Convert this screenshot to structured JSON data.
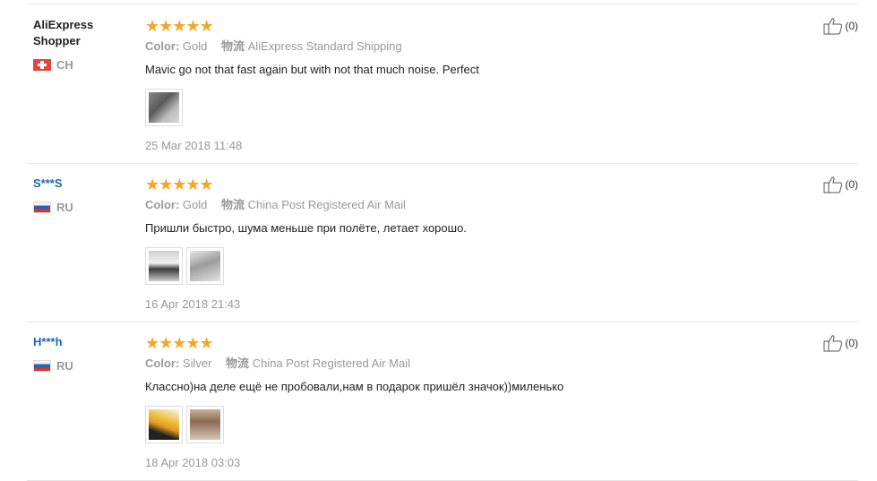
{
  "reviews": [
    {
      "user_name": "AliExpress Shopper",
      "country_code": "CH",
      "flag": "switzerland-flag",
      "rating": "★★★★★",
      "color_label": "Color:",
      "color_value": "Gold",
      "shipping_label": "物流",
      "shipping_value": "AliExpress Standard Shipping",
      "text": "Mavic go not that fast again but with not that much noise. Perfect",
      "photos": [
        "photo-1"
      ],
      "date": "25 Mar 2018 11:48",
      "likes": "(0)"
    },
    {
      "user_name": "S***S",
      "country_code": "RU",
      "flag": "russia-flag",
      "rating": "★★★★★",
      "color_label": "Color:",
      "color_value": "Gold",
      "shipping_label": "物流",
      "shipping_value": "China Post Registered Air Mail",
      "text": "Пришли быстро, шума меньше при полёте, летает хорошо.",
      "photos": [
        "photo-1",
        "photo-2"
      ],
      "date": "16 Apr 2018 21:43",
      "likes": "(0)"
    },
    {
      "user_name": "H***h",
      "country_code": "RU",
      "flag": "russia-flag",
      "rating": "★★★★★",
      "color_label": "Color:",
      "color_value": "Silver",
      "shipping_label": "物流",
      "shipping_value": "China Post Registered Air Mail",
      "text": "Классно)на деле ещё не пробовали,нам в подарок пришёл значок))миленько",
      "photos": [
        "photo-1",
        "photo-2"
      ],
      "date": "18 Apr 2018 03:03",
      "likes": "(0)"
    }
  ],
  "colors": {
    "star": "#f5a623",
    "link": "#1a66b5",
    "muted": "#999999"
  },
  "icons": {
    "like": "thumbs-up-icon",
    "rating": "star-icon"
  }
}
